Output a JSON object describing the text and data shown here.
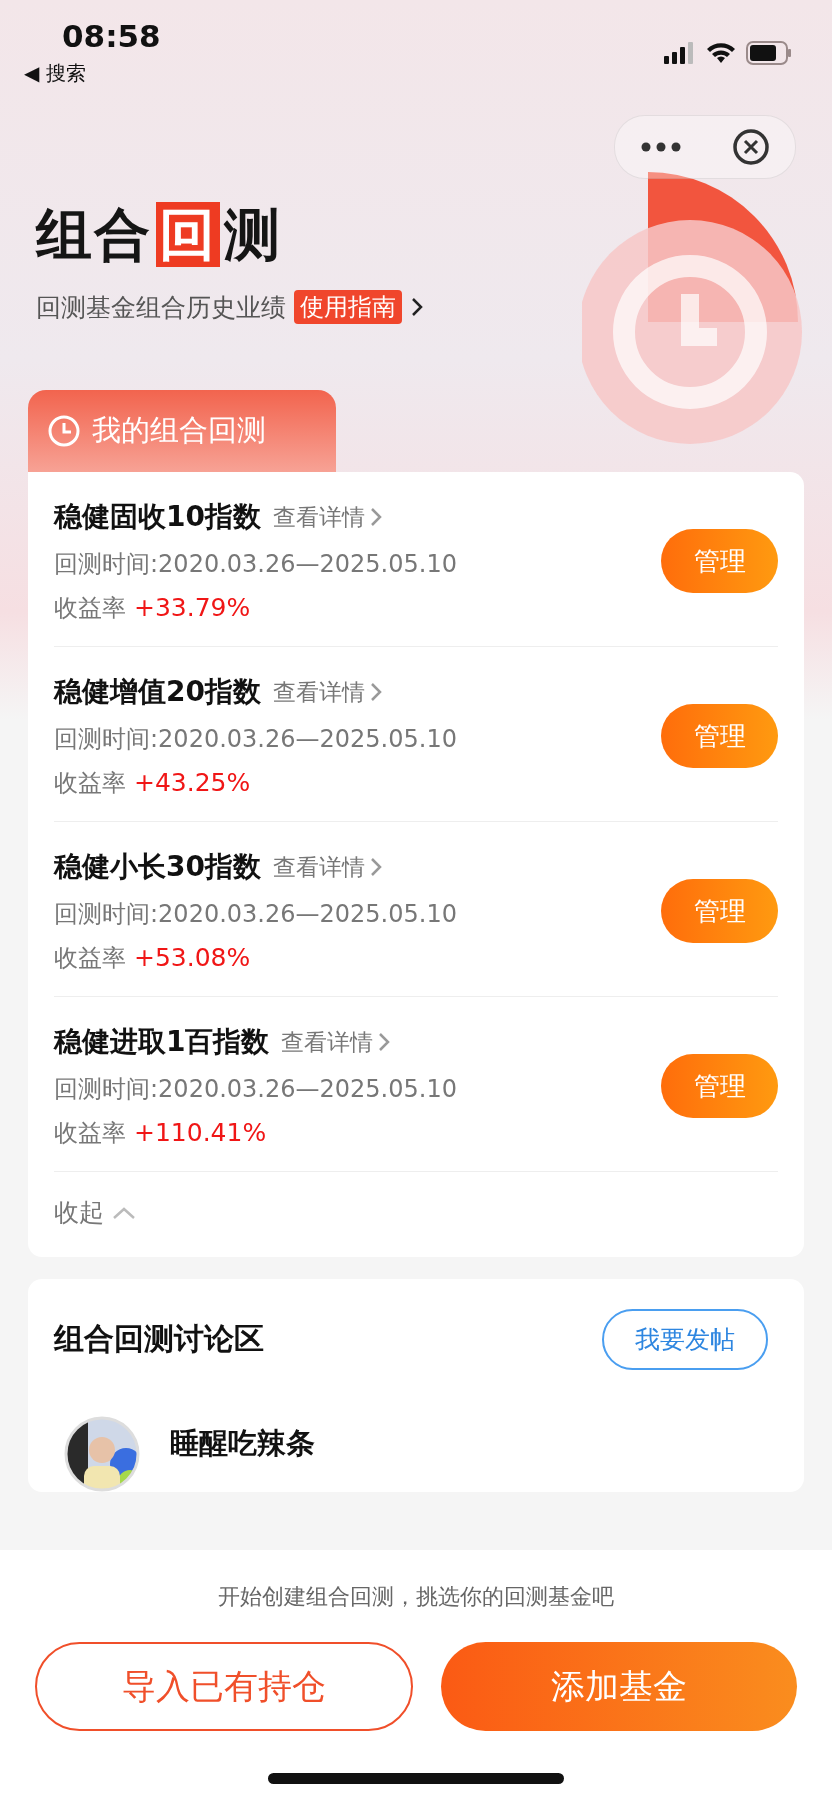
{
  "status_bar": {
    "time": "08:58",
    "back_label": "◀ 搜索"
  },
  "header": {
    "title_before": "组合",
    "title_highlight": "回",
    "title_after": "测",
    "subtitle": "回测基金组合历史业绩",
    "guide_badge": "使用指南"
  },
  "portfolio_section": {
    "tab_label": "我的组合回测",
    "items": [
      {
        "name": "稳健固收10指数",
        "detail_link": "查看详情",
        "period": "回测时间:2020.03.26—2025.05.10",
        "return_label": "收益率",
        "return_value": "+33.79%",
        "button": "管理"
      },
      {
        "name": "稳健增值20指数",
        "detail_link": "查看详情",
        "period": "回测时间:2020.03.26—2025.05.10",
        "return_label": "收益率",
        "return_value": "+43.25%",
        "button": "管理"
      },
      {
        "name": "稳健小长30指数",
        "detail_link": "查看详情",
        "period": "回测时间:2020.03.26—2025.05.10",
        "return_label": "收益率",
        "return_value": "+53.08%",
        "button": "管理"
      },
      {
        "name": "稳健进取1百指数",
        "detail_link": "查看详情",
        "period": "回测时间:2020.03.26—2025.05.10",
        "return_label": "收益率",
        "return_value": "+110.41%",
        "button": "管理"
      }
    ],
    "collapse_label": "收起",
    "expanded": true
  },
  "discussion": {
    "title": "组合回测讨论区",
    "post_button": "我要发帖",
    "posts": [
      {
        "author": "睡醒吃辣条"
      }
    ]
  },
  "bottom_bar": {
    "hint": "开始创建组合回测，挑选你的回测基金吧",
    "secondary_button": "导入已有持仓",
    "primary_button": "添加基金"
  }
}
